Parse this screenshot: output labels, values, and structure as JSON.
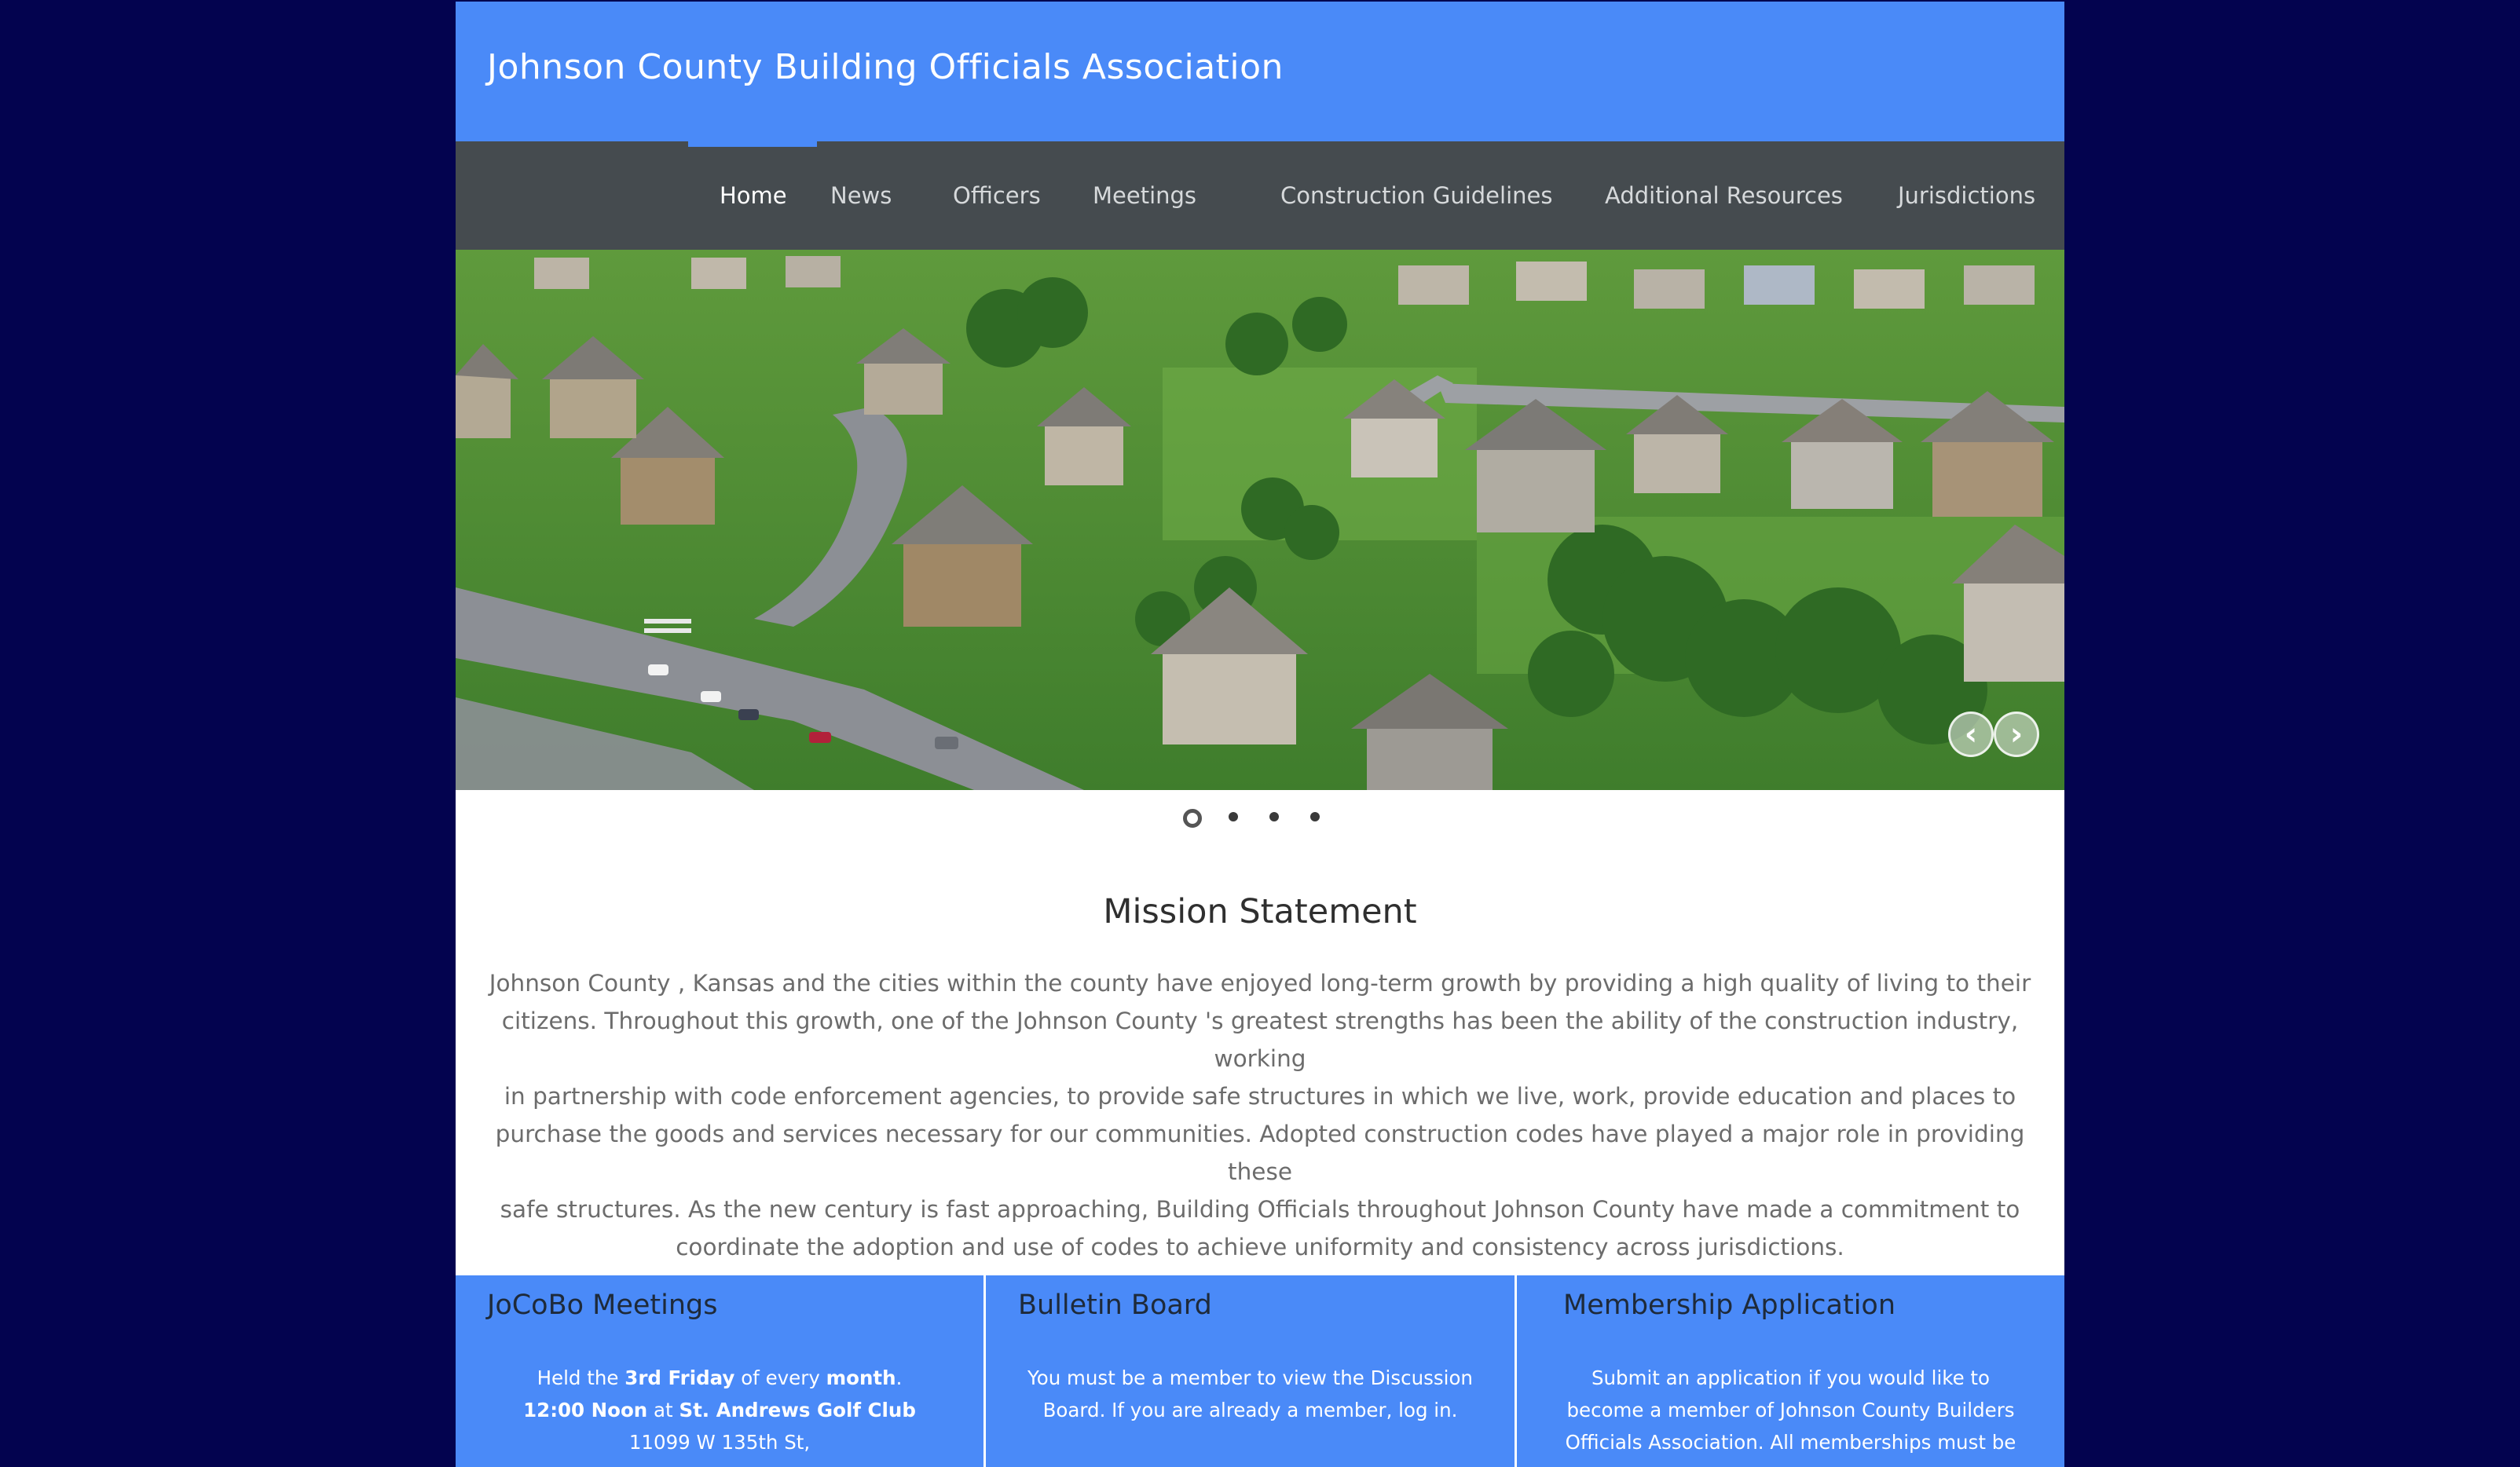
{
  "site": {
    "title": "Johnson County Building Officials Association"
  },
  "nav": {
    "items": [
      {
        "label": "Home"
      },
      {
        "label": "News"
      },
      {
        "label": "Officers"
      },
      {
        "label": "Meetings"
      },
      {
        "label": "Construction Guidelines"
      },
      {
        "label": "Additional Resources"
      },
      {
        "label": "Jurisdictions"
      }
    ],
    "active": "Home"
  },
  "slider": {
    "slide_count": 4,
    "active_slide": 1,
    "prev_icon": "arrow-left-icon",
    "next_icon": "arrow-right-icon"
  },
  "mission": {
    "title": "Mission Statement",
    "lines": [
      "Johnson County , Kansas and the cities within the county have enjoyed long-term growth by providing a high quality of living to their",
      "citizens. Throughout this growth, one of the Johnson County 's greatest strengths has been the ability of the construction industry, working",
      "in partnership with code enforcement agencies, to provide safe structures in which we live, work, provide education and places to",
      "purchase the goods and services necessary for our communities. Adopted construction codes have played a major role in providing these",
      "safe structures. As the new century is fast approaching, Building Officials throughout Johnson County have made a commitment to",
      "coordinate the adoption and use of codes to achieve uniformity and consistency across jurisdictions."
    ]
  },
  "panels": {
    "meetings": {
      "title": "JoCoBo Meetings",
      "line1_a": "Held the ",
      "line1_b": "3rd Friday",
      "line1_c": " of every ",
      "line1_d": "month",
      "line1_e": ".",
      "line2_a": "12:00 Noon",
      "line2_b": " at ",
      "line2_c": "St. Andrews Golf Club",
      "line3": "11099 W 135th St,"
    },
    "bulletin": {
      "title": "Bulletin Board",
      "line1": "You must be a member to view the Discussion",
      "line2": "Board.  If you are already a member, log in."
    },
    "membership": {
      "title": "Membership Application",
      "line1": "Submit an application if you would like to",
      "line2": "become a member of Johnson County Builders",
      "line3": "Officials Association.  All memberships must be"
    }
  },
  "colors": {
    "background": "#03034f",
    "header_blue": "#4a8af8",
    "nav_gray": "#454b4f"
  }
}
